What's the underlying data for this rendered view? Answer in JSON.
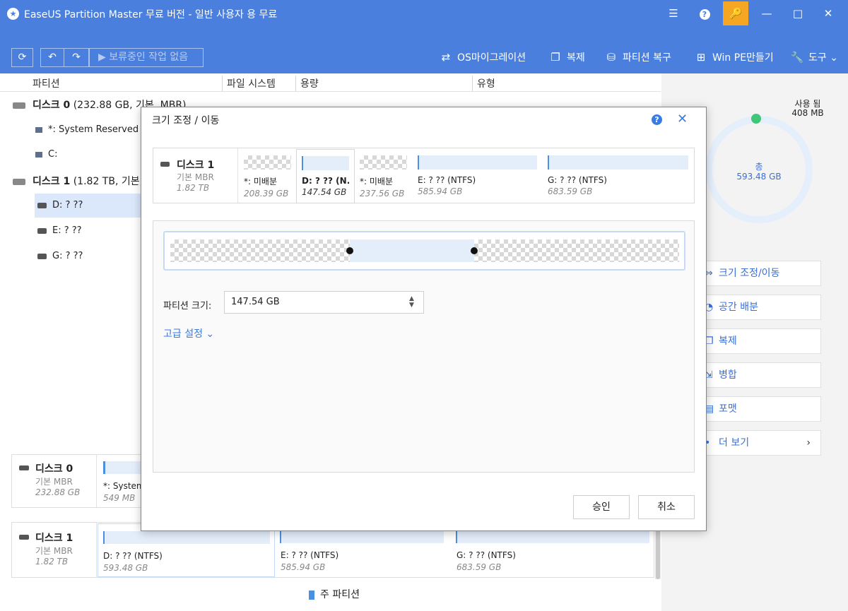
{
  "window": {
    "title": "EaseUS Partition Master 무료 버전 - 일반 사용자 용 무료",
    "logo_glyph": "★",
    "menu_glyph": "☰",
    "help_glyph": "?",
    "key_glyph": "🔑",
    "minimize_glyph": "—",
    "maximize_glyph": "□",
    "close_glyph": "✕"
  },
  "toolbar": {
    "refresh_glyph": "⟳",
    "undo_glyph": "↶",
    "redo_glyph": "↷",
    "pending_label": "▶ 보류중인 작업 없음",
    "items": [
      {
        "label": "OS마이그레이션",
        "icon": "⇄"
      },
      {
        "label": "복제",
        "icon": "❐"
      },
      {
        "label": "파티션 복구",
        "icon": "⛁"
      },
      {
        "label": "Win PE만들기",
        "icon": "⊞"
      },
      {
        "label": "도구",
        "icon": "🔧",
        "chevron": "⌄"
      }
    ]
  },
  "columns": [
    "파티션",
    "파일 시스템",
    "용량",
    "유형"
  ],
  "tree": {
    "disk0": {
      "name": "디스크 0",
      "detail": "(232.88 GB, 기본, MBR)"
    },
    "disk0_parts": [
      "*: System Reserved",
      "C:"
    ],
    "disk1": {
      "name": "디스크 1",
      "detail": "(1.82 TB, 기본,"
    },
    "disk1_parts": [
      "D: ? ??",
      "E: ? ??",
      "G: ? ??"
    ]
  },
  "right_panel": {
    "used_label": "사용 됨",
    "used_value": "408 MB",
    "total_label": "총",
    "total_value": "593.48 GB",
    "actions": [
      {
        "label": "크기 조정/이동",
        "icon": "⇔"
      },
      {
        "label": "공간 배분",
        "icon": "◔"
      },
      {
        "label": "복제",
        "icon": "❐"
      },
      {
        "label": "병합",
        "icon": "⇲"
      },
      {
        "label": "포맷",
        "icon": "▤"
      },
      {
        "label": "더 보기",
        "icon": "•",
        "chevron": "›"
      }
    ]
  },
  "bottom_maps": {
    "disk0": {
      "name": "디스크 0",
      "type": "기본 MBR",
      "size": "232.88 GB",
      "segments": [
        {
          "name": "*: System",
          "size": "549 MB"
        }
      ]
    },
    "disk1": {
      "name": "디스크 1",
      "type": "기본 MBR",
      "size": "1.82 TB",
      "segments": [
        {
          "name": "D: ? ?? (NTFS)",
          "size": "593.48 GB"
        },
        {
          "name": "E: ? ?? (NTFS)",
          "size": "585.94 GB"
        },
        {
          "name": "G: ? ?? (NTFS)",
          "size": "683.59 GB"
        }
      ]
    }
  },
  "legend": {
    "label": "주 파티션",
    "color": "#4a90e2"
  },
  "dialog": {
    "title": "크기 조정 / 이동",
    "help_glyph": "?",
    "close_glyph": "✕",
    "disk": {
      "name": "디스크 1",
      "type": "기본 MBR",
      "size": "1.82 TB"
    },
    "segments": [
      {
        "name": "*: 미배분",
        "size": "208.39 GB",
        "kind": "unallocated"
      },
      {
        "name": "D: ? ?? (N...",
        "size": "147.54 GB",
        "kind": "partition",
        "selected": true
      },
      {
        "name": "*: 미배분",
        "size": "237.56 GB",
        "kind": "unallocated"
      },
      {
        "name": "E: ? ?? (NTFS)",
        "size": "585.94 GB",
        "kind": "partition"
      },
      {
        "name": "G: ? ?? (NTFS)",
        "size": "683.59 GB",
        "kind": "partition"
      }
    ],
    "size_label": "파티션 크기:",
    "size_value": "147.54 GB",
    "spin_glyph": "▲▼",
    "advanced_label": "고급 설정 ⌄",
    "ok_label": "승인",
    "cancel_label": "취소"
  }
}
